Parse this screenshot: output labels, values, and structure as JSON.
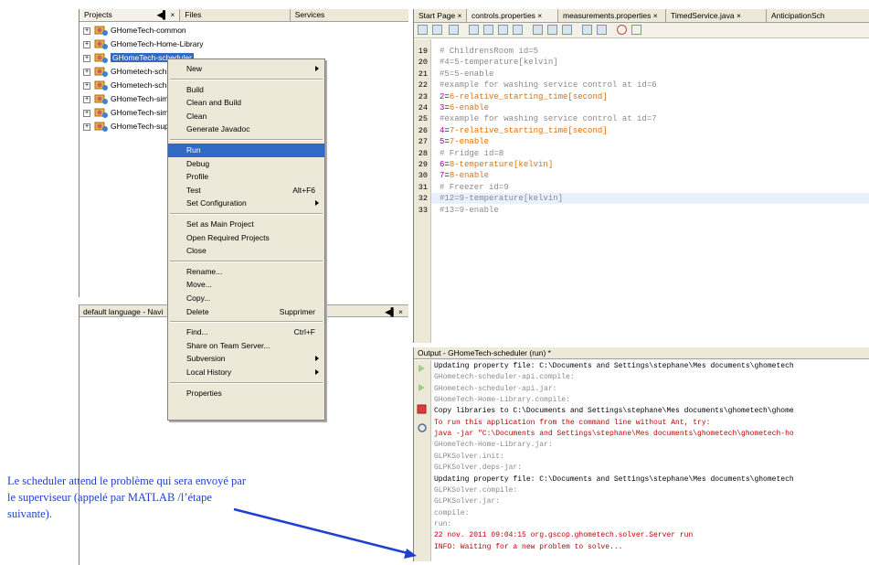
{
  "projects_panel": {
    "tabs": [
      "Projects",
      "Files",
      "Services"
    ],
    "tab_controls": "◀▌ ×",
    "tree": [
      {
        "label": "GHomeTech-common",
        "selected": false
      },
      {
        "label": "GHomeTech-Home-Library",
        "selected": false
      },
      {
        "label": "GHomeTech-scheduler",
        "selected": true
      },
      {
        "label": "GHometech-sch",
        "selected": false
      },
      {
        "label": "GHometech-sch",
        "selected": false
      },
      {
        "label": "GHomeTech-sim",
        "selected": false
      },
      {
        "label": "GHomeTech-sim",
        "selected": false
      },
      {
        "label": "GHomeTech-sup",
        "selected": false
      }
    ]
  },
  "context_menu": {
    "items": [
      {
        "label": "New",
        "shortcut": "",
        "submenu": true
      },
      {
        "sep": true
      },
      {
        "label": "Build",
        "shortcut": ""
      },
      {
        "label": "Clean and Build",
        "shortcut": ""
      },
      {
        "label": "Clean",
        "shortcut": ""
      },
      {
        "label": "Generate Javadoc",
        "shortcut": ""
      },
      {
        "sep": true
      },
      {
        "label": "Run",
        "shortcut": "",
        "highlight": true
      },
      {
        "label": "Debug",
        "shortcut": ""
      },
      {
        "label": "Profile",
        "shortcut": ""
      },
      {
        "label": "Test",
        "shortcut": "Alt+F6"
      },
      {
        "label": "Set Configuration",
        "shortcut": "",
        "submenu": true
      },
      {
        "sep": true
      },
      {
        "label": "Set as Main Project",
        "shortcut": ""
      },
      {
        "label": "Open Required Projects",
        "shortcut": ""
      },
      {
        "label": "Close",
        "shortcut": ""
      },
      {
        "sep": true
      },
      {
        "label": "Rename...",
        "shortcut": ""
      },
      {
        "label": "Move...",
        "shortcut": ""
      },
      {
        "label": "Copy...",
        "shortcut": ""
      },
      {
        "label": "Delete",
        "shortcut": "Supprimer"
      },
      {
        "sep": true
      },
      {
        "label": "Find...",
        "shortcut": "Ctrl+F"
      },
      {
        "label": "Share on Team Server...",
        "shortcut": ""
      },
      {
        "label": "Subversion",
        "shortcut": "",
        "submenu": true
      },
      {
        "label": "Local History",
        "shortcut": "",
        "submenu": true
      },
      {
        "sep": true
      },
      {
        "label": "Properties",
        "shortcut": ""
      }
    ]
  },
  "navigator": {
    "title": "default language - Navi",
    "controls": "◀▌ ×"
  },
  "editor": {
    "tabs": [
      "Start Page ×",
      "controls.properties ×",
      "measurements.properties ×",
      "TimedService.java ×",
      "AnticipationSch"
    ],
    "lines": [
      {
        "n": "19",
        "kind": "comment",
        "text": "# ChildrensRoom id=5"
      },
      {
        "n": "20",
        "kind": "comment",
        "text": "#4=5-temperature[kelvin]"
      },
      {
        "n": "21",
        "kind": "comment",
        "text": "#5=5-enable"
      },
      {
        "n": "22",
        "kind": "comment",
        "text": "#example for washing service control at id=6"
      },
      {
        "n": "23",
        "kind": "prop",
        "key": "2",
        "val": "6-relative_starting_time[second]"
      },
      {
        "n": "24",
        "kind": "prop",
        "key": "3",
        "val": "6-enable"
      },
      {
        "n": "25",
        "kind": "comment",
        "text": "#example for washing service control at id=7"
      },
      {
        "n": "26",
        "kind": "prop",
        "key": "4",
        "val": "7-relative_starting_time[second]"
      },
      {
        "n": "27",
        "kind": "prop",
        "key": "5",
        "val": "7-enable"
      },
      {
        "n": "28",
        "kind": "comment",
        "text": "# Fridge id=8"
      },
      {
        "n": "29",
        "kind": "prop",
        "key": "6",
        "val": "8-temperature[kelvin]"
      },
      {
        "n": "30",
        "kind": "prop",
        "key": "7",
        "val": "8-enable"
      },
      {
        "n": "31",
        "kind": "comment",
        "text": "# Freezer id=9"
      },
      {
        "n": "32",
        "kind": "comment",
        "text": "#12=9-temperature[kelvin]"
      },
      {
        "n": "33",
        "kind": "comment",
        "text": "#13=9-enable"
      }
    ]
  },
  "output": {
    "title": "Output - GHomeTech-scheduler (run) *",
    "lines": [
      {
        "c": "black",
        "t": "Updating property file: C:\\Documents and Settings\\stephane\\Mes documents\\ghometech"
      },
      {
        "c": "gray",
        "t": "GHometech-scheduler-api.compile:"
      },
      {
        "c": "gray",
        "t": "GHometech-scheduler-api.jar:"
      },
      {
        "c": "gray",
        "t": "GHomeTech-Home-Library.compile:"
      },
      {
        "c": "black",
        "t": "Copy libraries to C:\\Documents and Settings\\stephane\\Mes documents\\ghometech\\ghome"
      },
      {
        "c": "red",
        "t": "To run this application from the command line without Ant, try:"
      },
      {
        "c": "red",
        "t": "java -jar \"C:\\Documents and Settings\\stephane\\Mes documents\\ghometech\\ghometech-ho"
      },
      {
        "c": "gray",
        "t": "GHomeTech-Home-Library.jar:"
      },
      {
        "c": "gray",
        "t": "GLPKSolver.init:"
      },
      {
        "c": "gray",
        "t": "GLPKSolver.deps-jar:"
      },
      {
        "c": "black",
        "t": "Updating property file: C:\\Documents and Settings\\stephane\\Mes documents\\ghometech"
      },
      {
        "c": "gray",
        "t": "GLPKSolver.compile:"
      },
      {
        "c": "gray",
        "t": "GLPKSolver.jar:"
      },
      {
        "c": "gray",
        "t": "compile:"
      },
      {
        "c": "gray",
        "t": "run:"
      },
      {
        "c": "red",
        "t": "22 nov. 2011 09:04:15 org.gscop.ghometech.solver.Server run"
      },
      {
        "c": "red",
        "t": "INFO: Waiting for a new problem to solve..."
      }
    ]
  },
  "annotation": {
    "text": "Le scheduler attend le problème qui sera envoyé par le superviseur (appelé par MATLAB /l’étape suivante).",
    "color": "#1f3fd0"
  }
}
